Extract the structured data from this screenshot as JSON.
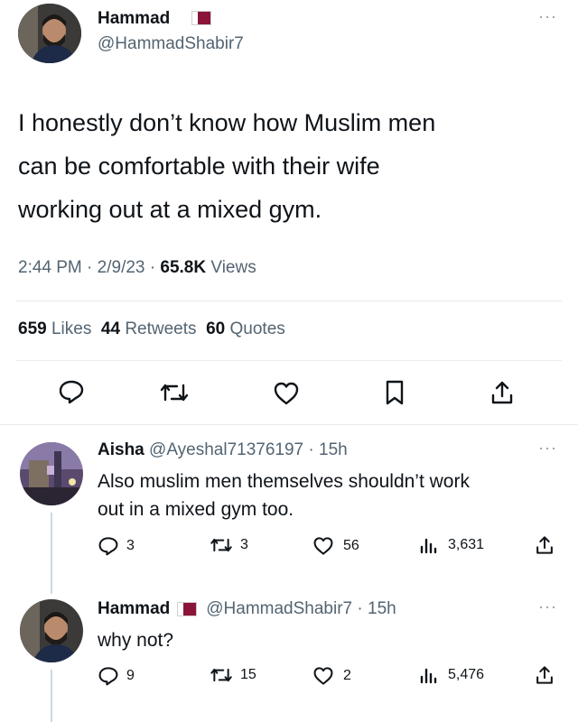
{
  "main_tweet": {
    "author_name": "Hammad",
    "author_handle": "@HammadShabir7",
    "text_lines": [
      "I honestly don’t know how Muslim men",
      "can be comfortable with their wife",
      "working out at a mixed gym."
    ],
    "time": "2:44 PM",
    "date": "2/9/23",
    "views_count": "65.8K",
    "views_label": "Views",
    "likes_count": "659",
    "likes_label": "Likes",
    "retweets_count": "44",
    "retweets_label": "Retweets",
    "quotes_count": "60",
    "quotes_label": "Quotes"
  },
  "replies": [
    {
      "author_name": "Aisha",
      "author_handle": "@Ayeshal71376197",
      "age": "15h",
      "text_lines": [
        "Also muslim men themselves shouldn’t work",
        "out in a mixed gym too."
      ],
      "replies": "3",
      "retweets": "3",
      "likes": "56",
      "views": "3,631"
    },
    {
      "author_name": "Hammad",
      "author_handle": "@HammadShabir7",
      "age": "15h",
      "text_lines": [
        "why not?"
      ],
      "replies": "9",
      "retweets": "15",
      "likes": "2",
      "views": "5,476"
    }
  ],
  "colors": {
    "flag": "#8a1538",
    "text": "#0f1419",
    "secondary": "#536471"
  },
  "icons": [
    "reply-icon",
    "retweet-icon",
    "like-icon",
    "bookmark-icon",
    "share-icon",
    "views-icon",
    "more-icon"
  ]
}
